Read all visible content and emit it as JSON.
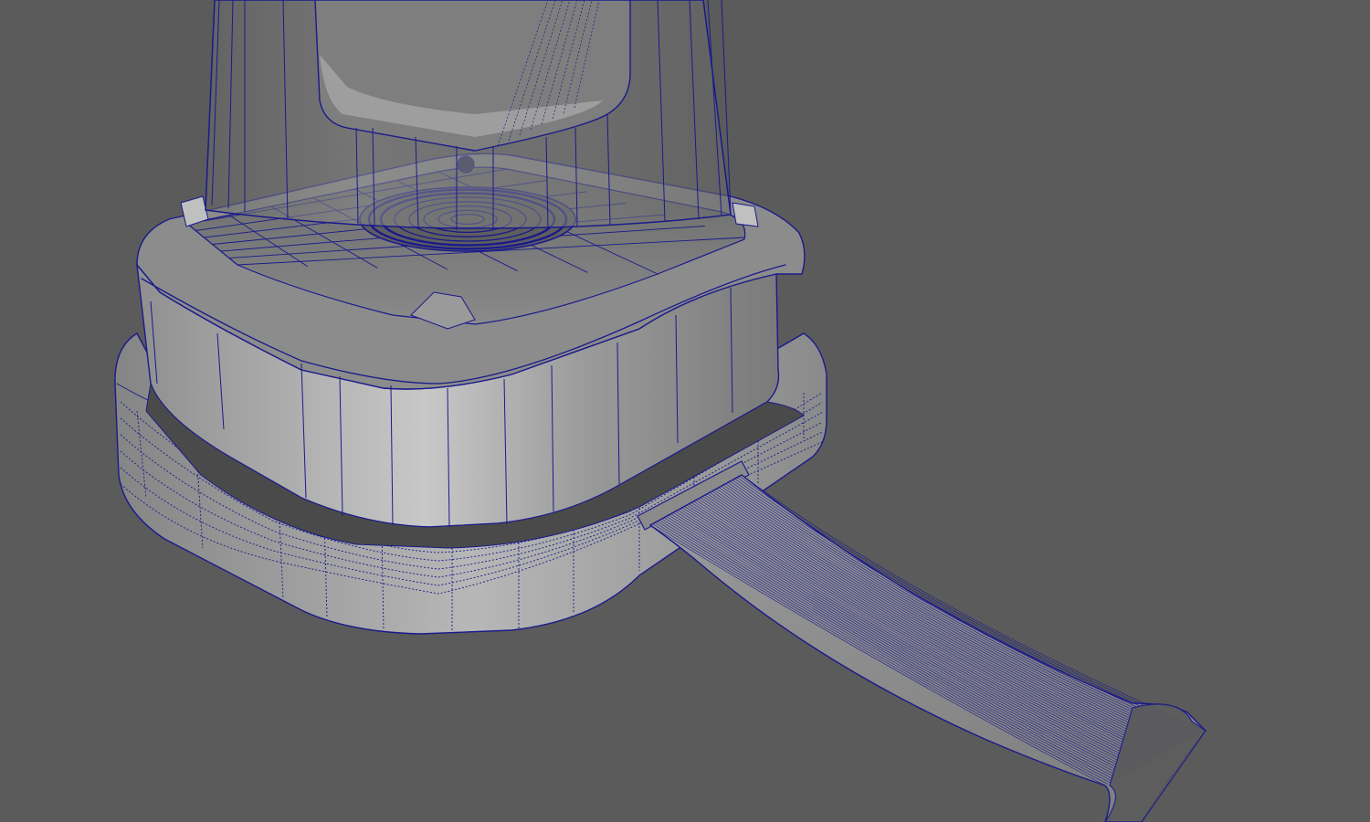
{
  "viewport": {
    "background": "#5b5b5b",
    "wire_color": "#1a1a8c",
    "wire_light": "#2a2ab0",
    "shade_light": "#c9c9c9",
    "shade_mid": "#a8a8a8",
    "shade_dark": "#6f6f6f",
    "shade_deep": "#4a4a4a"
  },
  "objects": {
    "base": {
      "display": "wireframe-on-shaded"
    },
    "jar": {
      "display": "wireframe-on-shaded"
    },
    "ribbon_cable": {
      "display": "wireframe-on-shaded"
    }
  }
}
